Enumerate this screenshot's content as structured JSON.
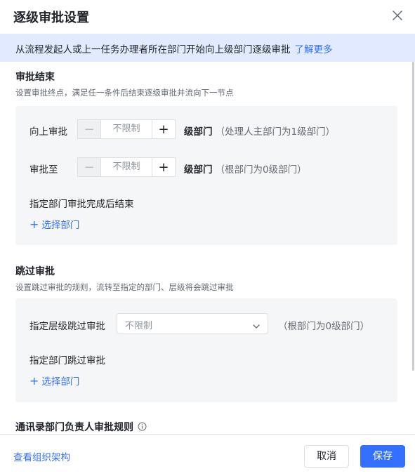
{
  "dialog": {
    "title": "逐级审批设置",
    "close_icon": "close-icon"
  },
  "notice": {
    "text": "从流程发起人或上一任务办理者所在部门开始向上级部门逐级审批",
    "link": "了解更多"
  },
  "approval_end": {
    "title": "审批结束",
    "desc": "设置审批终点，满足任一条件后结束逐级审批并流向下一节点",
    "up_row": {
      "label": "向上审批",
      "value": "不限制",
      "minus": "−",
      "plus": "+",
      "unit": "级部门",
      "hint": "（处理人主部门为1级部门）"
    },
    "to_row": {
      "label": "审批至",
      "value": "不限制",
      "minus": "−",
      "plus": "+",
      "unit": "级部门",
      "hint": "（根部门为0级部门）"
    },
    "dept_end_label": "指定部门审批完成后结束",
    "select_dept": "选择部门"
  },
  "skip": {
    "title": "跳过审批",
    "desc": "设置跳过审批的规则，流转至指定的部门、层级将会跳过审批",
    "level_label": "指定层级跳过审批",
    "level_select": "不限制",
    "level_hint": "（根部门为0级部门）",
    "dept_label": "指定部门跳过审批",
    "select_dept": "选择部门"
  },
  "contacts_rule": {
    "title": "通讯录部门负责人审批规则"
  },
  "footer": {
    "org_link": "查看组织架构",
    "cancel": "取消",
    "save": "保存"
  },
  "colors": {
    "accent": "#3370ff",
    "notice_bg": "#e1eaff",
    "panel_bg": "#f5f6f7"
  }
}
